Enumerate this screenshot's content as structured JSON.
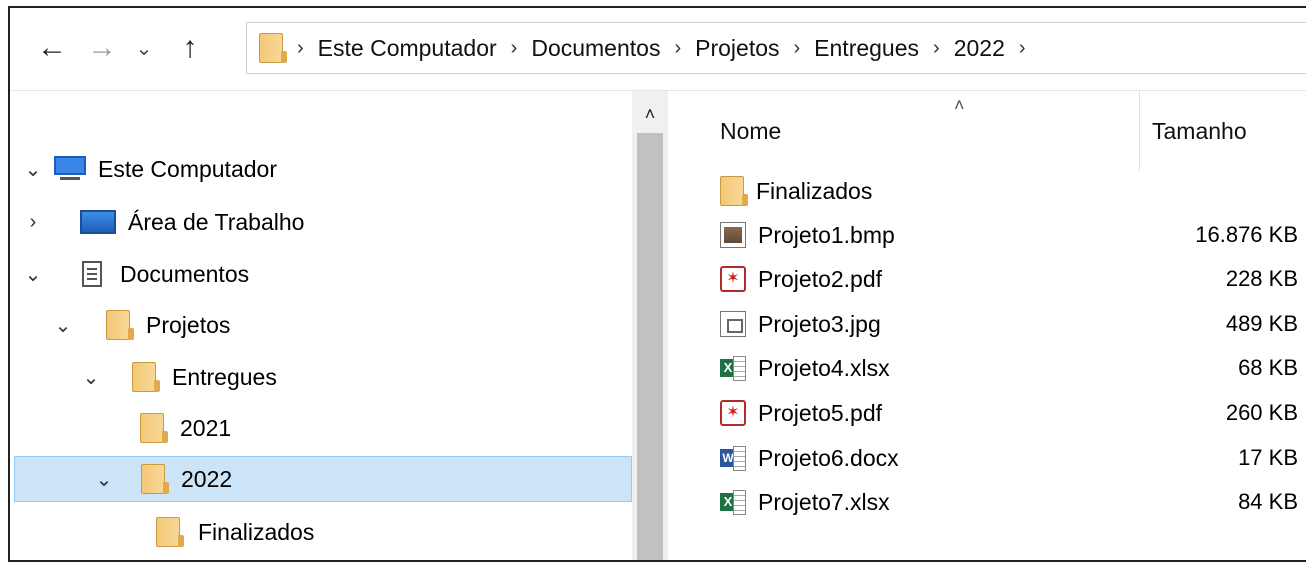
{
  "toolbar": {
    "back_icon": "←",
    "forward_icon": "→",
    "recent_icon": "⌄",
    "up_icon": "↑",
    "separator": "›",
    "breadcrumb": [
      "Este Computador",
      "Documentos",
      "Projetos",
      "Entregues",
      "2022"
    ]
  },
  "nav": {
    "items": [
      {
        "label": "Este Computador",
        "chevron": "⌄",
        "icon": "computer-icon",
        "level": 0
      },
      {
        "label": "Área de Trabalho",
        "chevron": "›",
        "icon": "desktop-icon",
        "level": 0
      },
      {
        "label": "Documentos",
        "chevron": "⌄",
        "icon": "document-icon",
        "level": 0
      },
      {
        "label": "Projetos",
        "chevron": "⌄",
        "icon": "folder-icon",
        "level": 1
      },
      {
        "label": "Entregues",
        "chevron": "⌄",
        "icon": "folder-icon",
        "level": 2
      },
      {
        "label": "2021",
        "chevron": "",
        "icon": "folder-icon",
        "level": 3
      },
      {
        "label": "2022",
        "chevron": "⌄",
        "icon": "folder-icon",
        "level": 3,
        "selected": true
      },
      {
        "label": "Finalizados",
        "chevron": "",
        "icon": "folder-icon",
        "level": 4
      }
    ],
    "scroll_up_icon": "˄"
  },
  "list": {
    "columns": {
      "name": "Nome",
      "size": "Tamanho",
      "sort_icon": "˄"
    },
    "files": [
      {
        "name": "Finalizados",
        "size": "",
        "icon": "folder-icon"
      },
      {
        "name": "Projeto1.bmp",
        "size": "16.876 KB",
        "icon": "bmp-file-icon"
      },
      {
        "name": "Projeto2.pdf",
        "size": "228 KB",
        "icon": "pdf-file-icon"
      },
      {
        "name": "Projeto3.jpg",
        "size": "489 KB",
        "icon": "jpg-file-icon"
      },
      {
        "name": "Projeto4.xlsx",
        "size": "68 KB",
        "icon": "excel-file-icon"
      },
      {
        "name": "Projeto5.pdf",
        "size": "260 KB",
        "icon": "pdf-file-icon"
      },
      {
        "name": "Projeto6.docx",
        "size": "17 KB",
        "icon": "word-file-icon"
      },
      {
        "name": "Projeto7.xlsx",
        "size": "84 KB",
        "icon": "excel-file-icon"
      }
    ]
  },
  "colors": {
    "selection_bg": "#cce4f7",
    "selection_border": "#99c9ef",
    "folder": "#f3c878",
    "pdf": "#b22a2a",
    "excel": "#1e7145",
    "word": "#2b579a"
  }
}
